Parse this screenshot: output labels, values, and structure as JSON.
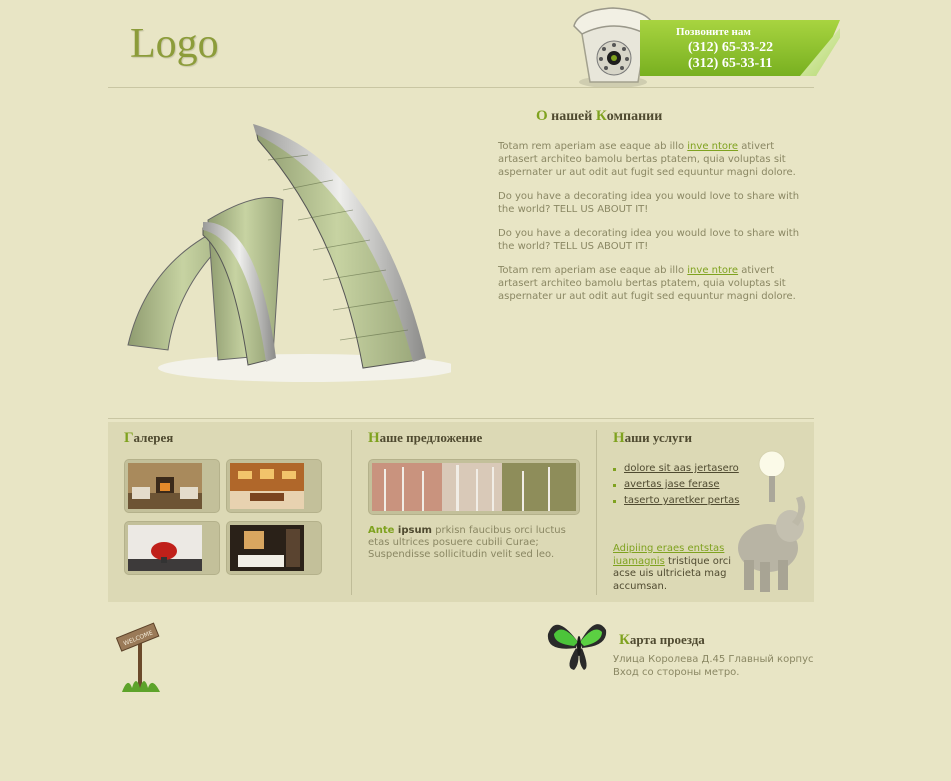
{
  "header": {
    "logo": "Logo",
    "phone_title": "Позвоните нам",
    "phone_1": "(312) 65-33-22",
    "phone_2": "(312) 65-33-11"
  },
  "about": {
    "title_first": "О",
    "title_mid": " нашей ",
    "title_k": "К",
    "title_rest": "омпании",
    "p1_before": "Totam rem aperiam ase eaque ab illo ",
    "p1_link": "inve ntore",
    "p1_after": " ativert artasert architeo bamolu bertas ptatem, quia voluptas sit aspernater ur aut odit aut fugit sed equuntur magni dolore.",
    "p2": "Do you have a decorating idea you would love to share with the world? TELL US ABOUT IT!",
    "p3": "Do you have a decorating idea you would love to share with the world? TELL US ABOUT IT!",
    "p4_before": "Totam rem aperiam ase eaque ab illo ",
    "p4_link": "inve ntore",
    "p4_after": " ativert artasert architeo bamolu bertas ptatem, quia voluptas sit aspernater ur aut odit aut fugit sed equuntur magni dolore."
  },
  "gallery": {
    "title_first": "Г",
    "title_rest": "алерея"
  },
  "offer": {
    "title_first": "Н",
    "title_rest": "аше предложение",
    "text_green": "Ante",
    "text_dark": " ipsum",
    "text_rest": " prkisn faucibus orci luctus etas ultrices posuere cubili Curae; Suspendisse sollicitudin velit sed leo."
  },
  "services": {
    "title_first": "Н",
    "title_rest": "аши услуги",
    "items": [
      "dolore sit aas jertasero",
      "avertas jase ferase",
      "taserto yaretker pertas"
    ],
    "link": "Adipiing eraes entstas iuamagnis",
    "text_after": " tristique orci acse uis ultricieta mag accumsan."
  },
  "map": {
    "title_first": "К",
    "title_rest": "арта проезда",
    "line1": "Улица Королева Д.45 Главный корпус",
    "line2": "Вход со стороны метро."
  },
  "welcome_sign": "WELCOME",
  "colors": {
    "background": "#e8e5c5",
    "accent": "#7fa21f",
    "panel": "#dcd9b5",
    "banner": "#8cc230"
  }
}
